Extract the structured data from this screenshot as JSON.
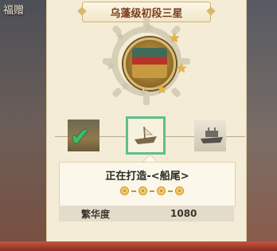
{
  "side": {
    "label": "福赠"
  },
  "header": {
    "title": "乌蓬级初段三星"
  },
  "stars": {
    "filled_count": 3,
    "total": 8,
    "filled_color": "#e7b53a",
    "empty_color": "#cfc6b2"
  },
  "slots": [
    {
      "name": "completed-part",
      "icon": "check-icon",
      "status": "completed"
    },
    {
      "name": "current-part",
      "icon": "ship-stern-icon",
      "status": "building"
    },
    {
      "name": "next-part",
      "icon": "ship-next-icon",
      "status": "locked"
    }
  ],
  "card": {
    "status_text": "正在打造-<船尾>",
    "progress_dots": 4
  },
  "stat": {
    "label": "繁华度",
    "value": "1080"
  },
  "colors": {
    "accent": "#5fbf8a",
    "title": "#7b3d1e",
    "panel": "#f4ecd6"
  }
}
